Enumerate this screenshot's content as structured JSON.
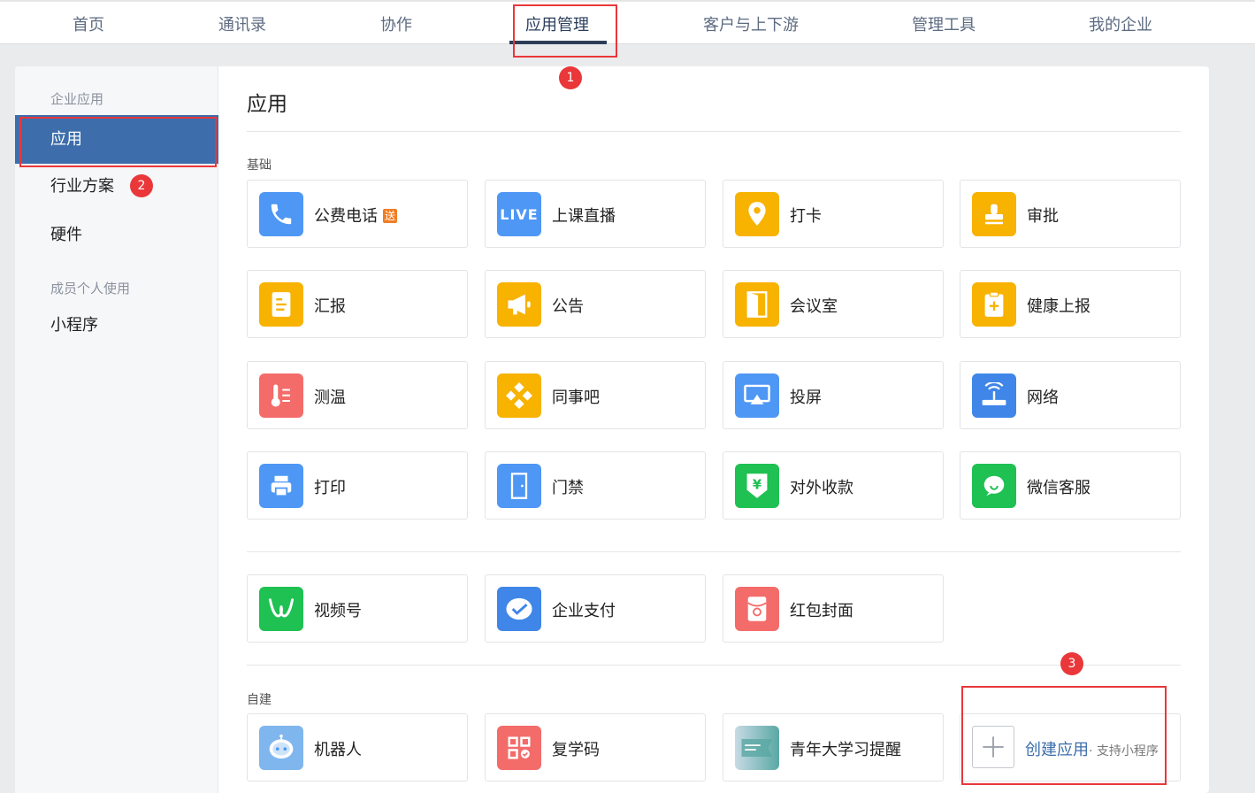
{
  "nav": {
    "items": [
      "首页",
      "通讯录",
      "协作",
      "应用管理",
      "客户与上下游",
      "管理工具",
      "我的企业"
    ]
  },
  "annotations": [
    "1",
    "2",
    "3"
  ],
  "sidebar": {
    "group1": "企业应用",
    "items1": [
      "应用",
      "行业方案",
      "硬件"
    ],
    "group2": "成员个人使用",
    "items2": [
      "小程序"
    ]
  },
  "content": {
    "title": "应用",
    "section_basic": "基础",
    "section_custom": "自建"
  },
  "apps": {
    "row1": [
      {
        "label": "公费电话",
        "tag": "送",
        "icon": "phone-icon"
      },
      {
        "label": "上课直播",
        "icon": "live-icon",
        "icon_text": "LIVE"
      },
      {
        "label": "打卡",
        "icon": "location-pin-icon"
      },
      {
        "label": "审批",
        "icon": "stamp-icon"
      }
    ],
    "row2": [
      {
        "label": "汇报",
        "icon": "report-icon"
      },
      {
        "label": "公告",
        "icon": "megaphone-icon"
      },
      {
        "label": "会议室",
        "icon": "door-icon"
      },
      {
        "label": "健康上报",
        "icon": "clipboard-plus-icon"
      }
    ],
    "row3": [
      {
        "label": "测温",
        "icon": "thermometer-icon"
      },
      {
        "label": "同事吧",
        "icon": "flower-icon"
      },
      {
        "label": "投屏",
        "icon": "screen-cast-icon"
      },
      {
        "label": "网络",
        "icon": "router-icon"
      }
    ],
    "row4": [
      {
        "label": "打印",
        "icon": "printer-icon"
      },
      {
        "label": "门禁",
        "icon": "door-access-icon"
      },
      {
        "label": "对外收款",
        "icon": "yuan-shield-icon"
      },
      {
        "label": "微信客服",
        "icon": "chat-bubble-icon"
      }
    ],
    "row5": [
      {
        "label": "视频号",
        "icon": "channels-icon"
      },
      {
        "label": "企业支付",
        "icon": "pay-check-icon"
      },
      {
        "label": "红包封面",
        "icon": "red-packet-icon"
      }
    ],
    "custom": [
      {
        "label": "机器人",
        "icon": "robot-icon"
      },
      {
        "label": "复学码",
        "icon": "qr-code-icon"
      },
      {
        "label": "青年大学习提醒",
        "icon": "banner-icon"
      }
    ]
  },
  "create": {
    "label": "创建应用",
    "sub": "· 支持小程序"
  },
  "colors": {
    "accent": "#3d6eab",
    "annotation_red": "#e9373a"
  }
}
